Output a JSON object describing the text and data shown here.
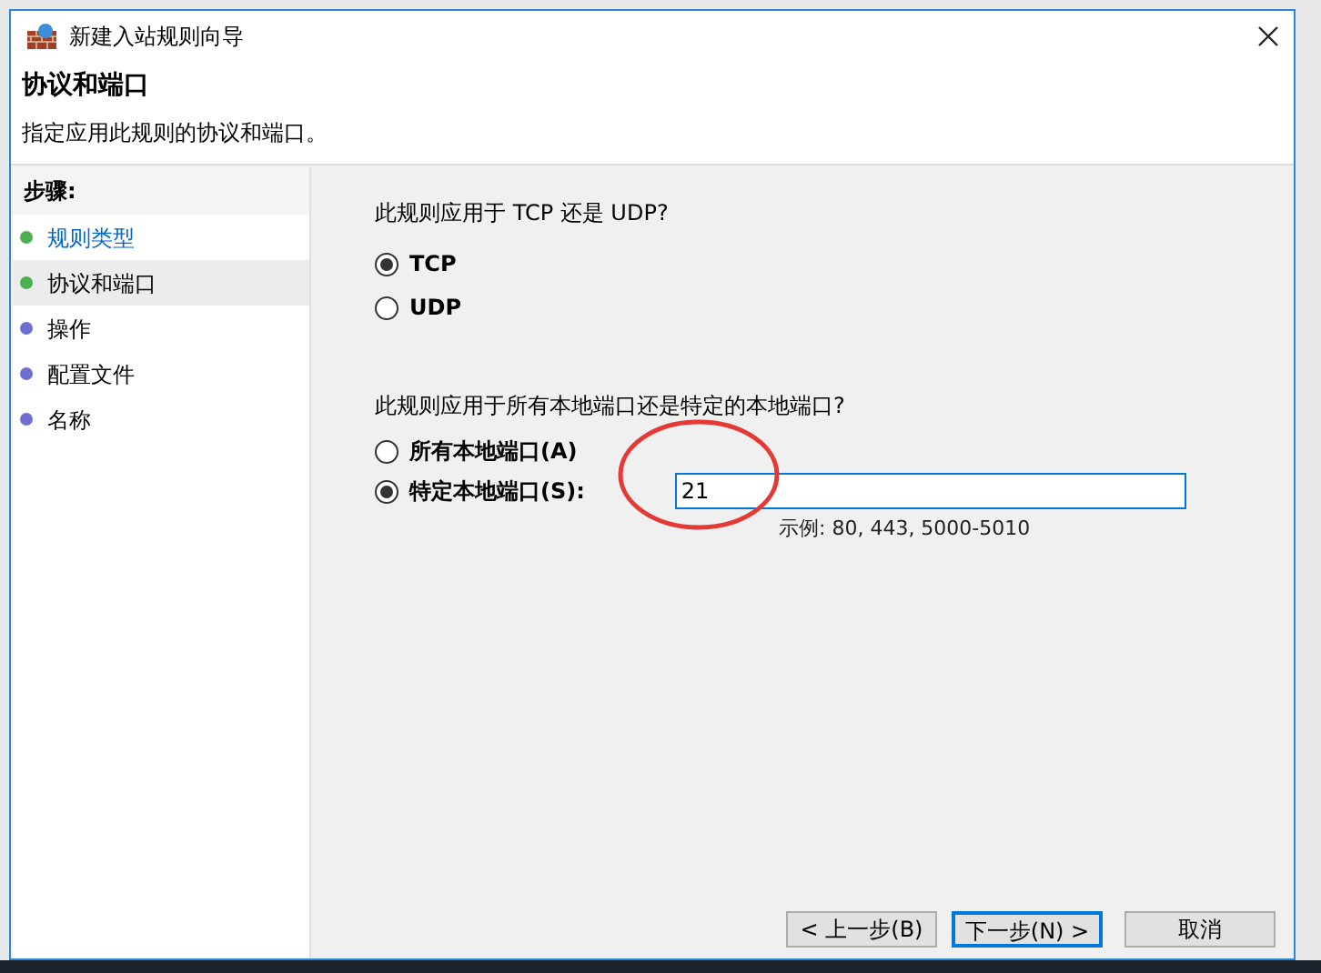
{
  "window": {
    "title": "新建入站规则向导"
  },
  "header": {
    "title": "协议和端口",
    "subtitle": "指定应用此规则的协议和端口。"
  },
  "steps": {
    "heading": "步骤:",
    "items": [
      {
        "label": "规则类型",
        "selected": false,
        "link": true,
        "color": "#4caf50"
      },
      {
        "label": "协议和端口",
        "selected": true,
        "link": false,
        "color": "#4caf50"
      },
      {
        "label": "操作",
        "selected": false,
        "link": false,
        "color": "#6f6fd0"
      },
      {
        "label": "配置文件",
        "selected": false,
        "link": false,
        "color": "#6f6fd0"
      },
      {
        "label": "名称",
        "selected": false,
        "link": false,
        "color": "#6f6fd0"
      }
    ]
  },
  "protocol": {
    "question": "此规则应用于 TCP 还是 UDP?",
    "options": [
      {
        "label": "TCP",
        "selected": true
      },
      {
        "label": "UDP",
        "selected": false
      }
    ]
  },
  "ports": {
    "question": "此规则应用于所有本地端口还是特定的本地端口?",
    "options": [
      {
        "label": "所有本地端口(A)",
        "selected": false
      },
      {
        "label": "特定本地端口(S):",
        "selected": true
      }
    ],
    "value": "21",
    "example": "示例: 80, 443, 5000-5010"
  },
  "buttons": [
    {
      "label": "< 上一步(B)",
      "default": false
    },
    {
      "label": "下一步(N) >",
      "default": true
    },
    {
      "label": "取消",
      "default": false
    }
  ]
}
